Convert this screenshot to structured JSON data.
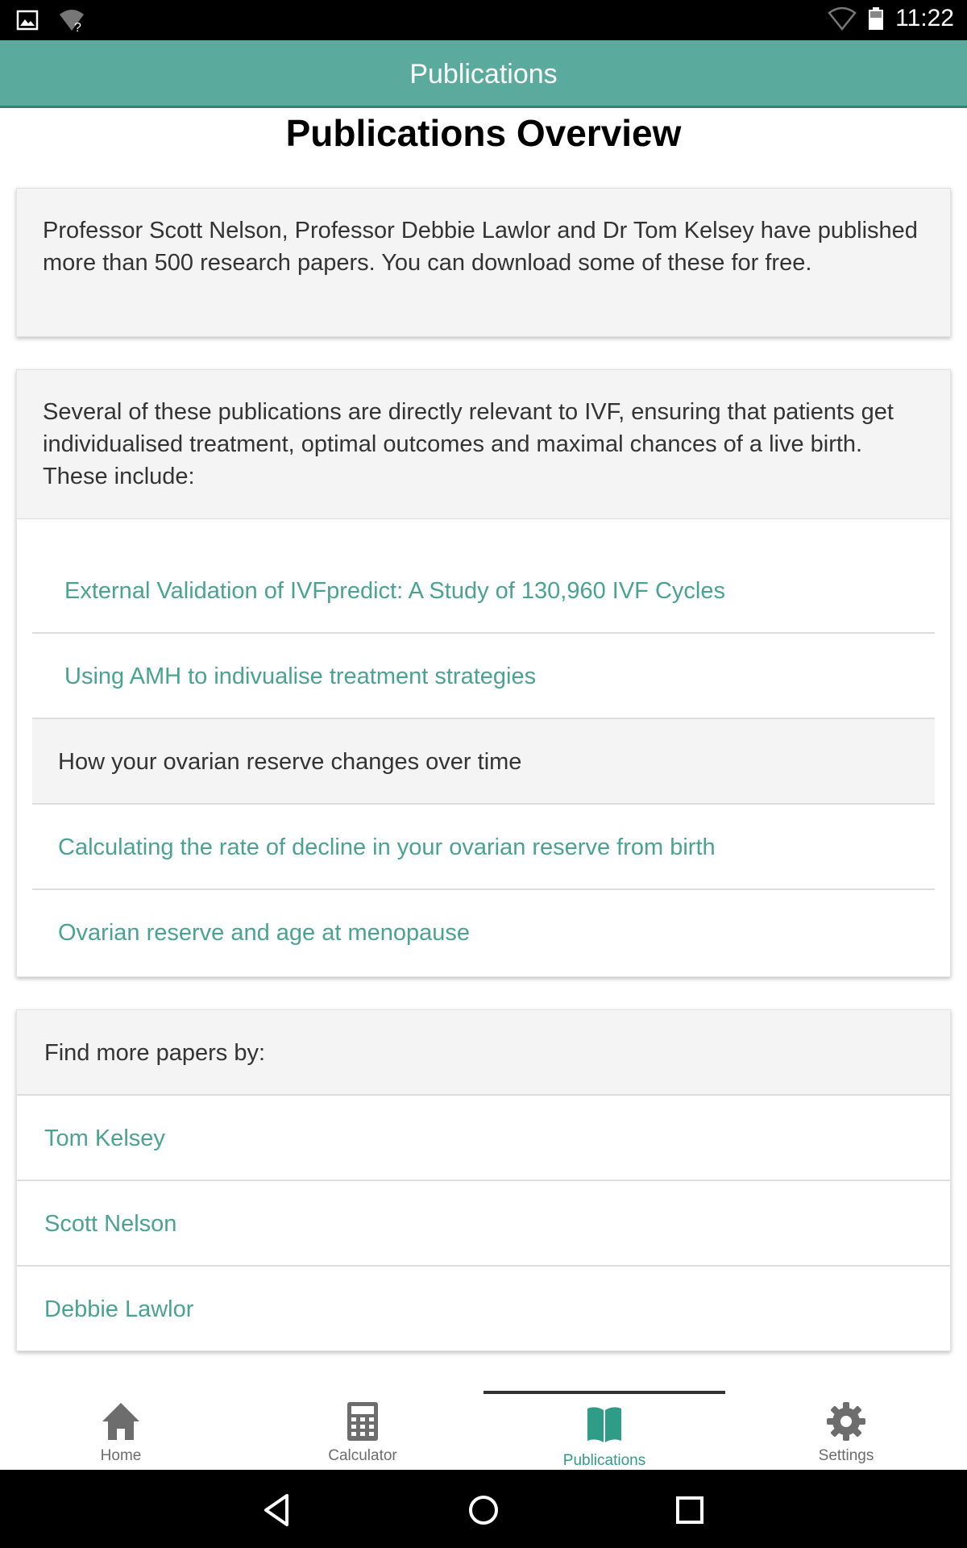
{
  "status_bar": {
    "time": "11:22",
    "icons": [
      "image-icon",
      "wifi-unknown-icon",
      "wifi-icon",
      "battery-icon"
    ]
  },
  "header": {
    "title": "Publications"
  },
  "page": {
    "title": "Publications Overview",
    "intro": "Professor Scott Nelson, Professor Debbie Lawlor and Dr Tom Kelsey have published more than 500 research papers. You can download some of these for free.",
    "ivf_intro": "Several of these publications are directly relevant to IVF, ensuring that patients get individualised treatment, optimal outcomes and maximal chances of a live birth. These include:",
    "publications": [
      {
        "label": "External Validation of IVFpredict: A Study of 130,960 IVF Cycles",
        "link": true
      },
      {
        "label": "Using AMH to indivualise treatment strategies",
        "link": true
      },
      {
        "label": "How your ovarian reserve changes over time",
        "link": false
      },
      {
        "label": "Calculating the rate of decline in your ovarian reserve from birth",
        "link": true
      },
      {
        "label": "Ovarian reserve and age at menopause",
        "link": true
      }
    ],
    "more_heading": "Find more papers by:",
    "authors": [
      "Tom Kelsey",
      "Scott Nelson",
      "Debbie Lawlor"
    ]
  },
  "tabs": [
    {
      "label": "Home",
      "icon": "home-icon",
      "active": false
    },
    {
      "label": "Calculator",
      "icon": "calculator-icon",
      "active": false
    },
    {
      "label": "Publications",
      "icon": "book-icon",
      "active": true
    },
    {
      "label": "Settings",
      "icon": "gear-icon",
      "active": false
    }
  ],
  "colors": {
    "header": "#5aab9d",
    "link": "#4aa392",
    "active_tab": "#2e9c87",
    "card_gray": "#f4f4f4"
  }
}
